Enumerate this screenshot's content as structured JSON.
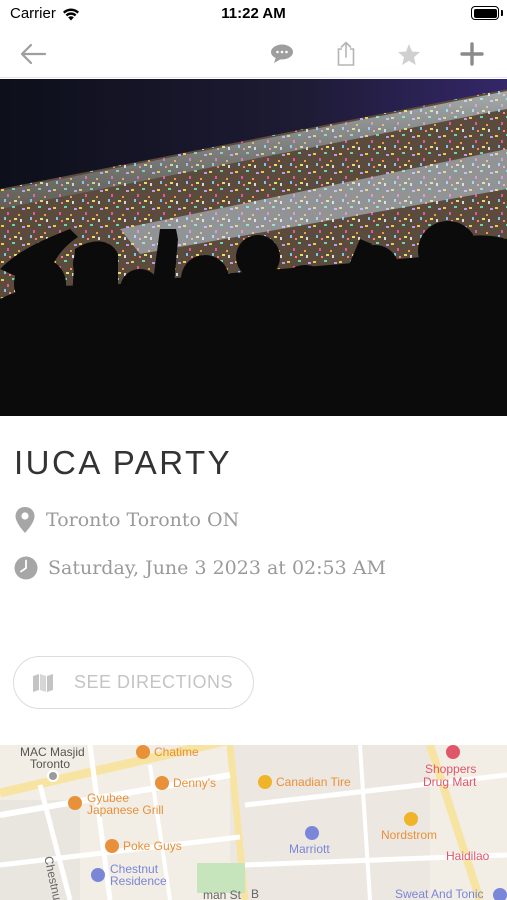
{
  "status_bar": {
    "carrier": "Carrier",
    "time": "11:22 AM"
  },
  "nav": {
    "back_icon": "back-arrow-icon",
    "comment_icon": "comment-icon",
    "share_icon": "share-icon",
    "favorite_icon": "star-icon",
    "add_icon": "plus-icon"
  },
  "event": {
    "title": "IUCA PARTY",
    "location": "Toronto Toronto ON",
    "datetime": "Saturday, June 3 2023 at 02:53 AM",
    "directions_label": "SEE DIRECTIONS"
  },
  "map": {
    "labels": {
      "mac_masjid": "MAC Masjid",
      "toronto": "Toronto",
      "chatime": "Chatime",
      "dennys": "Denny's",
      "canadian_tire": "Canadian Tire",
      "shoppers": "Shoppers",
      "drug_mart": "Drug Mart",
      "gyubee": "Gyubee",
      "japanese_grill": "Japanese Grill",
      "marriott": "Marriott",
      "nordstrom": "Nordstrom",
      "poke_guys": "Poke Guys",
      "chestnut_st": "Chestnut St",
      "chestnut": "Chestnut",
      "residence": "Residence",
      "haidilao": "Haidilao",
      "sweat_tonic": "Sweat And Tonic",
      "man_st": "man St",
      "b_st": "B"
    }
  },
  "colors": {
    "accent_icon": "#9e9e9e",
    "poi_orange": "#e8903a",
    "poi_red": "#e0566a",
    "poi_blue": "#7a86d8",
    "poi_yellow": "#f0b429"
  }
}
